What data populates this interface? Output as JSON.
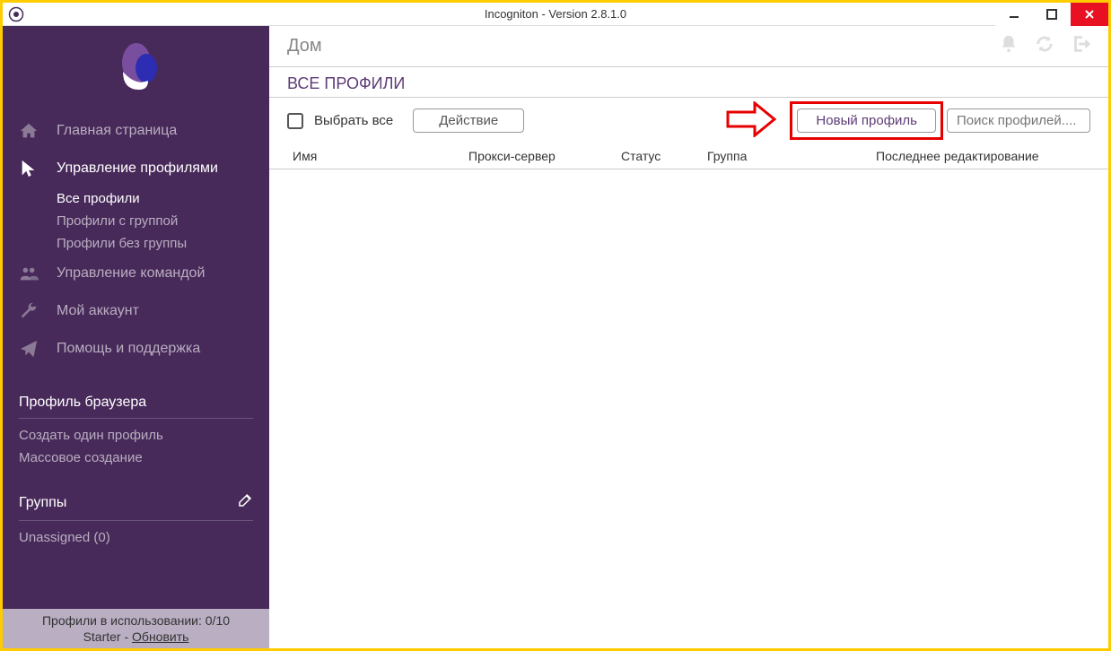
{
  "window": {
    "title": "Incogniton - Version 2.8.1.0"
  },
  "sidebar": {
    "nav": [
      {
        "icon": "home",
        "label": "Главная страница"
      },
      {
        "icon": "cursor",
        "label": "Управление профилями",
        "active": true
      },
      {
        "icon": "team",
        "label": "Управление командой"
      },
      {
        "icon": "wrench",
        "label": "Мой аккаунт"
      },
      {
        "icon": "paper-plane",
        "label": "Помощь и поддержка"
      }
    ],
    "profile_sub": [
      {
        "label": "Все профили",
        "active": true
      },
      {
        "label": "Профили с группой"
      },
      {
        "label": "Профили без группы"
      }
    ],
    "browser_profile": {
      "header": "Профиль браузера",
      "items": [
        {
          "label": "Создать один профиль"
        },
        {
          "label": "Массовое создание"
        }
      ]
    },
    "groups": {
      "header": "Группы",
      "items": [
        {
          "label": "Unassigned (0)"
        }
      ]
    },
    "footer": {
      "line1_prefix": "Профили в использовании:  ",
      "line1_count": "0/10",
      "line2_prefix": "Starter - ",
      "line2_link": "Обновить"
    }
  },
  "main": {
    "breadcrumb": "Дом",
    "section_title": "ВСЕ ПРОФИЛИ",
    "toolbar": {
      "select_all": "Выбрать все",
      "action_btn": "Действие",
      "new_profile_btn": "Новый профиль",
      "search_placeholder": "Поиск профилей...."
    },
    "columns": {
      "name": "Имя",
      "proxy": "Прокси-сервер",
      "status": "Статус",
      "group": "Группа",
      "edited": "Последнее редактирование"
    }
  }
}
